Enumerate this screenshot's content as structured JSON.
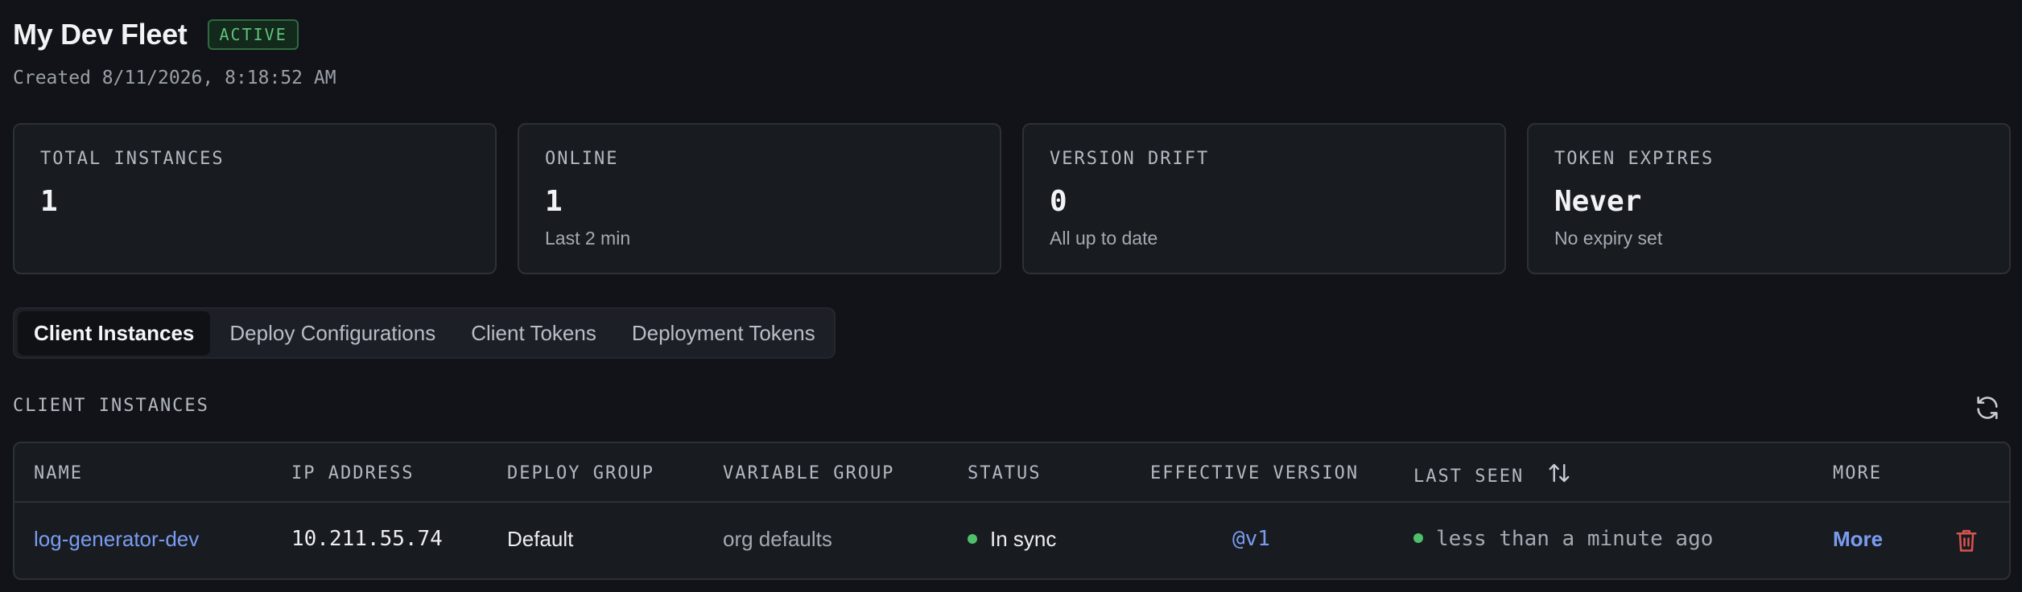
{
  "fleet": {
    "title": "My Dev Fleet",
    "status_badge": "ACTIVE",
    "created": "Created 8/11/2026, 8:18:52 AM"
  },
  "stats": [
    {
      "label": "TOTAL INSTANCES",
      "value": "1",
      "sub": ""
    },
    {
      "label": "ONLINE",
      "value": "1",
      "sub": "Last 2 min"
    },
    {
      "label": "VERSION DRIFT",
      "value": "0",
      "sub": "All up to date"
    },
    {
      "label": "TOKEN EXPIRES",
      "value": "Never",
      "sub": "No expiry set"
    }
  ],
  "tabs": [
    {
      "label": "Client Instances",
      "active": true
    },
    {
      "label": "Deploy Configurations",
      "active": false
    },
    {
      "label": "Client Tokens",
      "active": false
    },
    {
      "label": "Deployment Tokens",
      "active": false
    }
  ],
  "section": {
    "title": "CLIENT INSTANCES",
    "refresh_icon": "refresh-icon"
  },
  "table": {
    "columns": [
      "NAME",
      "IP ADDRESS",
      "DEPLOY GROUP",
      "VARIABLE GROUP",
      "STATUS",
      "EFFECTIVE VERSION",
      "LAST SEEN",
      "MORE"
    ],
    "rows": [
      {
        "name": "log-generator-dev",
        "ip": "10.211.55.74",
        "deploy_group": "Default",
        "variable_group": "org defaults",
        "status": "In sync",
        "version": "@v1",
        "last_seen": "less than a minute ago",
        "more": "More"
      }
    ]
  },
  "colors": {
    "background": "#111318",
    "accent": "#7a9cf0",
    "success": "#4fbf6a",
    "danger": "#d9534f"
  }
}
